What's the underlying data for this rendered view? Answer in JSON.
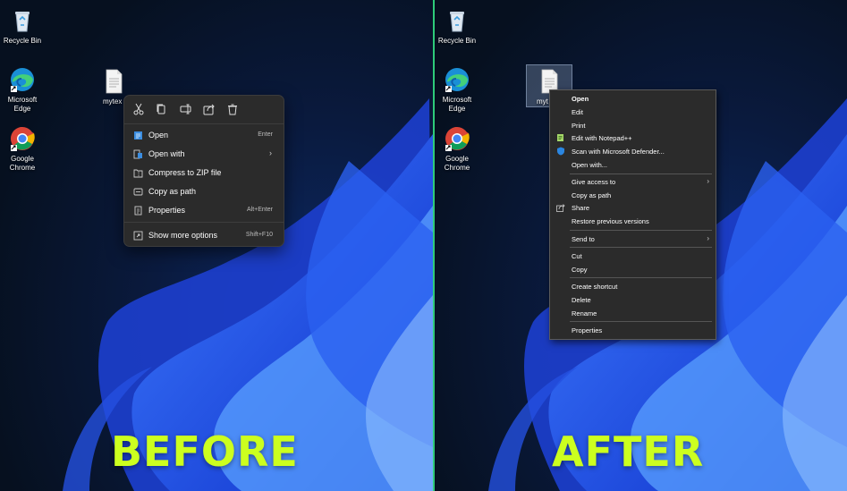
{
  "desktop_icons": {
    "recycle_bin": "Recycle Bin",
    "edge_line1": "Microsoft",
    "edge_line2": "Edge",
    "chrome_line1": "Google",
    "chrome_line2": "Chrome",
    "file_before": "mytex",
    "file_after": "myt"
  },
  "before": {
    "caption": "BEFORE",
    "toolbar_icons": [
      "cut-icon",
      "copy-icon",
      "rename-icon",
      "share-icon",
      "delete-icon"
    ],
    "items": [
      {
        "label": "Open",
        "shortcut": "Enter",
        "icon": "open-icon"
      },
      {
        "label": "Open with",
        "shortcut": "",
        "icon": "open-with-icon",
        "submenu": true
      },
      {
        "label": "Compress to ZIP file",
        "shortcut": "",
        "icon": "zip-icon"
      },
      {
        "label": "Copy as path",
        "shortcut": "",
        "icon": "copy-path-icon"
      },
      {
        "label": "Properties",
        "shortcut": "Alt+Enter",
        "icon": "properties-icon"
      },
      {
        "label": "Show more options",
        "shortcut": "Shift+F10",
        "icon": "more-options-icon"
      }
    ],
    "submenu_arrow": "›"
  },
  "after": {
    "caption": "AFTER",
    "items": {
      "open": "Open",
      "edit": "Edit",
      "print": "Print",
      "edit_notepad": "Edit with Notepad++",
      "scan_defender": "Scan with Microsoft Defender...",
      "open_with": "Open with...",
      "give_access": "Give access to",
      "copy_as_path": "Copy as path",
      "share": "Share",
      "restore": "Restore previous versions",
      "send_to": "Send to",
      "cut": "Cut",
      "copy": "Copy",
      "create_shortcut": "Create shortcut",
      "delete": "Delete",
      "rename": "Rename",
      "properties": "Properties"
    },
    "submenu_arrow": "›"
  },
  "colors": {
    "divider": "#2ecb7a",
    "caption": "#ccff1f",
    "menu_bg": "#2b2b2b"
  }
}
